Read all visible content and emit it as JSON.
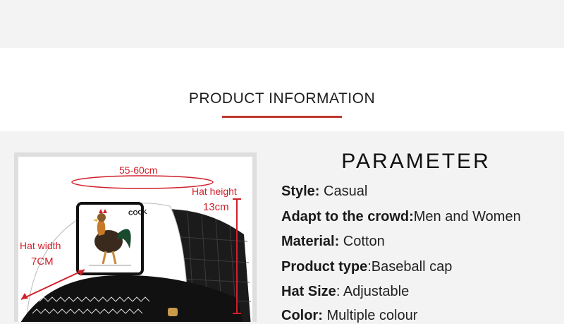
{
  "section": {
    "title": "PRODUCT  INFORMATION",
    "accent": "#c0392b"
  },
  "image": {
    "patch_text": "COCK",
    "annotations": {
      "circumference": "55-60cm",
      "height_label": "Hat height",
      "height_value": "13cm",
      "width_label": "Hat width",
      "width_value": "7CM"
    },
    "annotation_color": "#d0202a"
  },
  "parameter": {
    "title": "PARAMETER",
    "rows": [
      {
        "label": "Style:",
        "value": " Casual"
      },
      {
        "label": "Adapt to the crowd:",
        "value": "Men and Women"
      },
      {
        "label": "Material:",
        "value": " Cotton"
      },
      {
        "label": "Product type",
        "value": ":Baseball cap"
      },
      {
        "label": "Hat Size",
        "value": ": Adjustable"
      },
      {
        "label": "Color:",
        "value": " Multiple colour"
      }
    ]
  }
}
